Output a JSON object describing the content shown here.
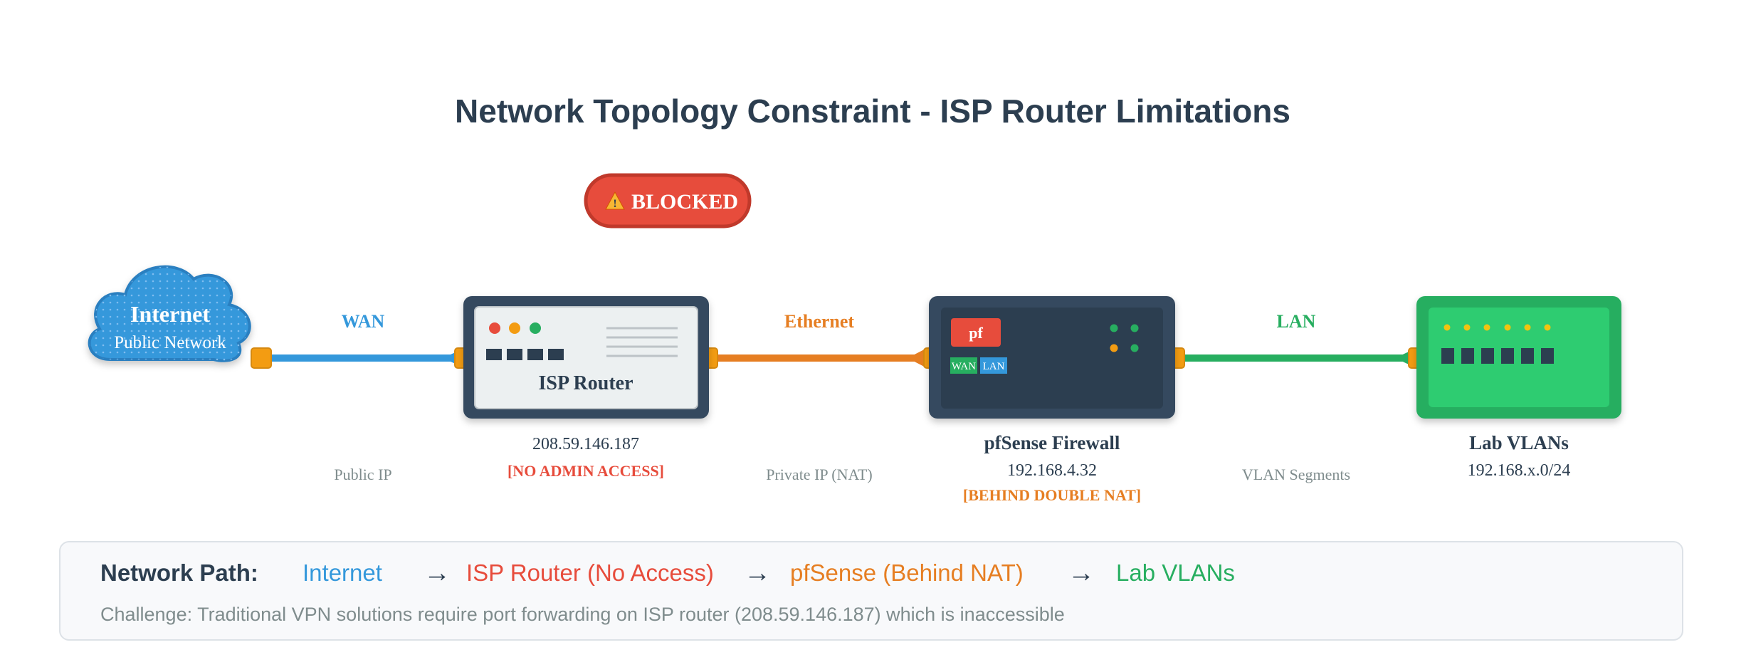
{
  "title": "Network Topology Constraint - ISP Router Limitations",
  "blocked_badge": {
    "icon": "warning-icon",
    "label": "BLOCKED"
  },
  "colors": {
    "title": "#2c3e50",
    "wan": "#3498db",
    "ethernet": "#e67e22",
    "lan": "#27ae60",
    "blocked": "#e74c3c",
    "connector": "#f39c12",
    "device_dark": "#34495e",
    "muted": "#7f8c8d"
  },
  "nodes": {
    "internet": {
      "label": "Internet",
      "sublabel": "Public Network",
      "icon": "cloud-icon"
    },
    "isp_router": {
      "label": "ISP Router",
      "ip": "208.59.146.187",
      "note": "[NO ADMIN ACCESS]",
      "icon": "router-icon"
    },
    "pfsense": {
      "label": "pfSense Firewall",
      "ip": "192.168.4.32",
      "note": "[BEHIND DOUBLE NAT]",
      "badge": "pf",
      "port_wan": "WAN",
      "port_lan": "LAN",
      "icon": "firewall-icon"
    },
    "lab_vlans": {
      "label": "Lab VLANs",
      "ip": "192.168.x.0/24",
      "icon": "switch-icon"
    }
  },
  "links": {
    "wan": {
      "label": "WAN",
      "sublabel": "Public IP"
    },
    "ethernet": {
      "label": "Ethernet",
      "sublabel": "Private IP (NAT)"
    },
    "lan": {
      "label": "LAN",
      "sublabel": "VLAN Segments"
    }
  },
  "network_path": {
    "title": "Network Path:",
    "arrow": "→",
    "steps": [
      {
        "label": "Internet",
        "color": "#3498db"
      },
      {
        "label": "ISP Router (No Access)",
        "color": "#e74c3c"
      },
      {
        "label": "pfSense (Behind NAT)",
        "color": "#e67e22"
      },
      {
        "label": "Lab VLANs",
        "color": "#27ae60"
      }
    ],
    "challenge": "Challenge: Traditional VPN solutions require port forwarding on ISP router (208.59.146.187) which is inaccessible"
  }
}
